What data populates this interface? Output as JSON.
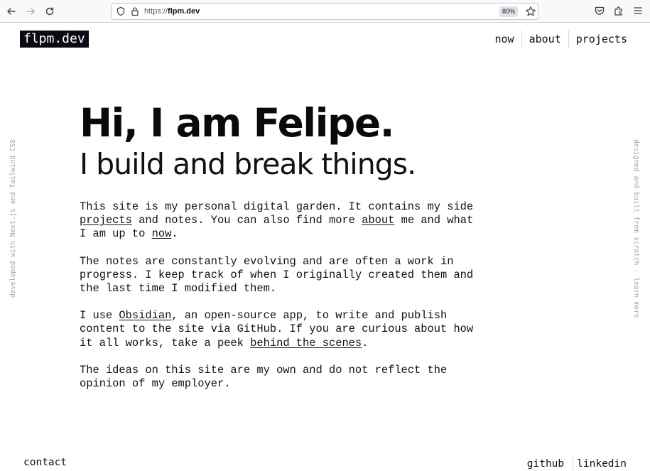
{
  "browser": {
    "url_prefix": "https://",
    "url_domain": "flpm.dev",
    "zoom": "80%",
    "icons": [
      "back-arrow-icon",
      "forward-arrow-icon",
      "reload-icon",
      "shield-icon",
      "lock-icon",
      "star-icon",
      "pocket-icon",
      "extensions-icon",
      "menu-icon"
    ]
  },
  "header": {
    "logo": "flpm.dev",
    "nav": [
      {
        "label": "now"
      },
      {
        "label": "about"
      },
      {
        "label": "projects"
      }
    ]
  },
  "side": {
    "left": "developed with Next.js and Tailwind CSS",
    "right": "designed and built from scratch - learn more"
  },
  "hero": {
    "title": "Hi, I am Felipe.",
    "subtitle": "I build and break things."
  },
  "body": {
    "p1_a": "This site is my personal digital garden. It contains my side ",
    "p1_link1": "projects",
    "p1_b": " and notes. You can also find more ",
    "p1_link2": "about",
    "p1_c": " me and what I am up to ",
    "p1_link3": "now",
    "p1_d": ".",
    "p2": "The notes are constantly evolving and are often a work in progress. I keep track of when I originally created them and the last time I modified them.",
    "p3_a": "I use ",
    "p3_link1": "Obsidian",
    "p3_b": ", an open-source app, to write and publish content to the site via GitHub. If you are curious about how it all works, take a peek ",
    "p3_link2": "behind the scenes",
    "p3_c": ".",
    "p4": "The ideas on this site are my own and do not reflect the opinion of my employer."
  },
  "footer": {
    "contact": "contact",
    "links": [
      {
        "label": "github"
      },
      {
        "label": "linkedin"
      }
    ]
  },
  "colors": {
    "logo_bg": "#0a0a12",
    "side_text": "#9aa6b8",
    "text": "#111111"
  }
}
